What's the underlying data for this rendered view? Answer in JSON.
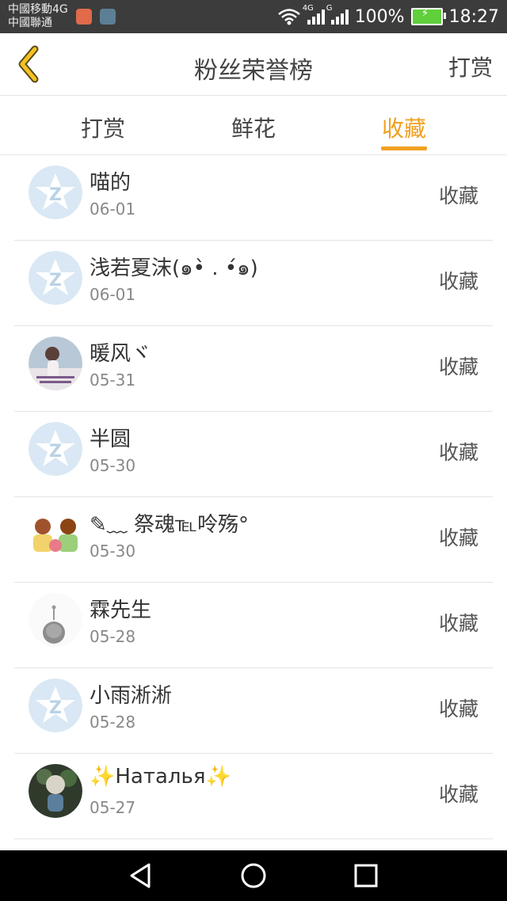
{
  "status_bar": {
    "carrier_1": "中國移動4G",
    "carrier_2": "中國聯通",
    "net_1": "4G",
    "net_2": "G",
    "battery": "100%",
    "time": "18:27"
  },
  "header": {
    "title": "粉丝荣誉榜",
    "action": "打赏",
    "back_icon": "chevron-left-icon"
  },
  "tabs": [
    {
      "label": "打赏",
      "active": false
    },
    {
      "label": "鲜花",
      "active": false
    },
    {
      "label": "收藏",
      "active": true
    }
  ],
  "accent_color": "#f0a020",
  "items": [
    {
      "name": "喵的",
      "date": "06-01",
      "action": "收藏",
      "avatar": "default-qq-avatar"
    },
    {
      "name": "浅若夏沫(๑•̀ . •́๑)",
      "date": "06-01",
      "action": "收藏",
      "avatar": "default-qq-avatar"
    },
    {
      "name": "暖风ヾ",
      "date": "05-31",
      "action": "收藏",
      "avatar": "photo-avatar"
    },
    {
      "name": "半圆",
      "date": "05-30",
      "action": "收藏",
      "avatar": "default-qq-avatar"
    },
    {
      "name": "✎﹏ 祭魂℡呤殇°",
      "date": "05-30",
      "action": "收藏",
      "avatar": "photo-avatar"
    },
    {
      "name": "霖先生",
      "date": "05-28",
      "action": "收藏",
      "avatar": "photo-avatar"
    },
    {
      "name": "小雨淅淅",
      "date": "05-28",
      "action": "收藏",
      "avatar": "default-qq-avatar"
    },
    {
      "name": "✨Наталья✨",
      "date": "05-27",
      "action": "收藏",
      "avatar": "photo-avatar"
    }
  ]
}
